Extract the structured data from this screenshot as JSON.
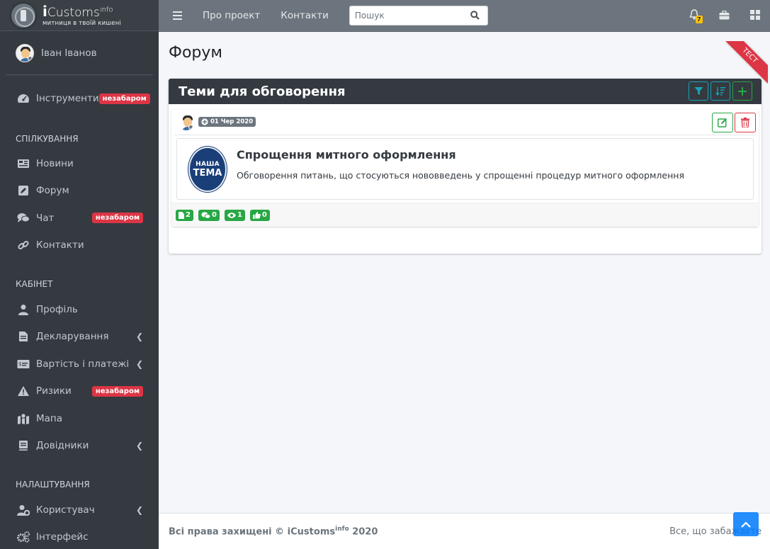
{
  "brand": {
    "name_prefix": "i",
    "name": "Customs",
    "sup": "info",
    "tagline": "митниця в твоїй кишені"
  },
  "user": {
    "name": "Іван Іванов"
  },
  "sidebar": {
    "tools": {
      "label": "Інструменти",
      "badge": "незабаром"
    },
    "section_communication": "СПІЛКУВАННЯ",
    "news": {
      "label": "Новини"
    },
    "forum": {
      "label": "Форум"
    },
    "chat": {
      "label": "Чат",
      "badge": "незабаром"
    },
    "contacts": {
      "label": "Контакти"
    },
    "section_cabinet": "КАБІНЕТ",
    "profile": {
      "label": "Профіль"
    },
    "declaring": {
      "label": "Декларування"
    },
    "costs": {
      "label": "Вартість і платежі"
    },
    "risks": {
      "label": "Ризики",
      "badge": "незабаром"
    },
    "map": {
      "label": "Мапа"
    },
    "references": {
      "label": "Довідники"
    },
    "section_settings": "НАЛАШТУВАННЯ",
    "user_item": {
      "label": "Користувач"
    },
    "interface": {
      "label": "Інтерфейс"
    }
  },
  "topbar": {
    "about": "Про проект",
    "contacts": "Контакти",
    "search_placeholder": "Пошук",
    "notifications_count": "7"
  },
  "page": {
    "title": "Форум",
    "ribbon": "ТЕСТ"
  },
  "card": {
    "title": "Теми для обговорення",
    "post": {
      "date": "01 Чер 2020",
      "logo_line1": "НАША",
      "logo_line2": "ТЕМА",
      "topic_title": "Спрощення митного оформлення",
      "topic_desc": "Обговорення питань, що стосуються нововведень у спрощенні процедур митного оформлення",
      "stats": {
        "files": "2",
        "comments": "0",
        "views": "1",
        "likes": "0"
      }
    }
  },
  "footer": {
    "left_prefix": "Всі права захищені © iCustoms",
    "left_sup": "info",
    "left_suffix": " 2020",
    "right": "Все, що забажаєте"
  },
  "colors": {
    "sidebar": "#343a40",
    "topbar": "#6c757d",
    "danger": "#dc3545",
    "success": "#28a745",
    "info": "#17a2b8",
    "warning": "#ffc107",
    "primary": "#007bff"
  }
}
